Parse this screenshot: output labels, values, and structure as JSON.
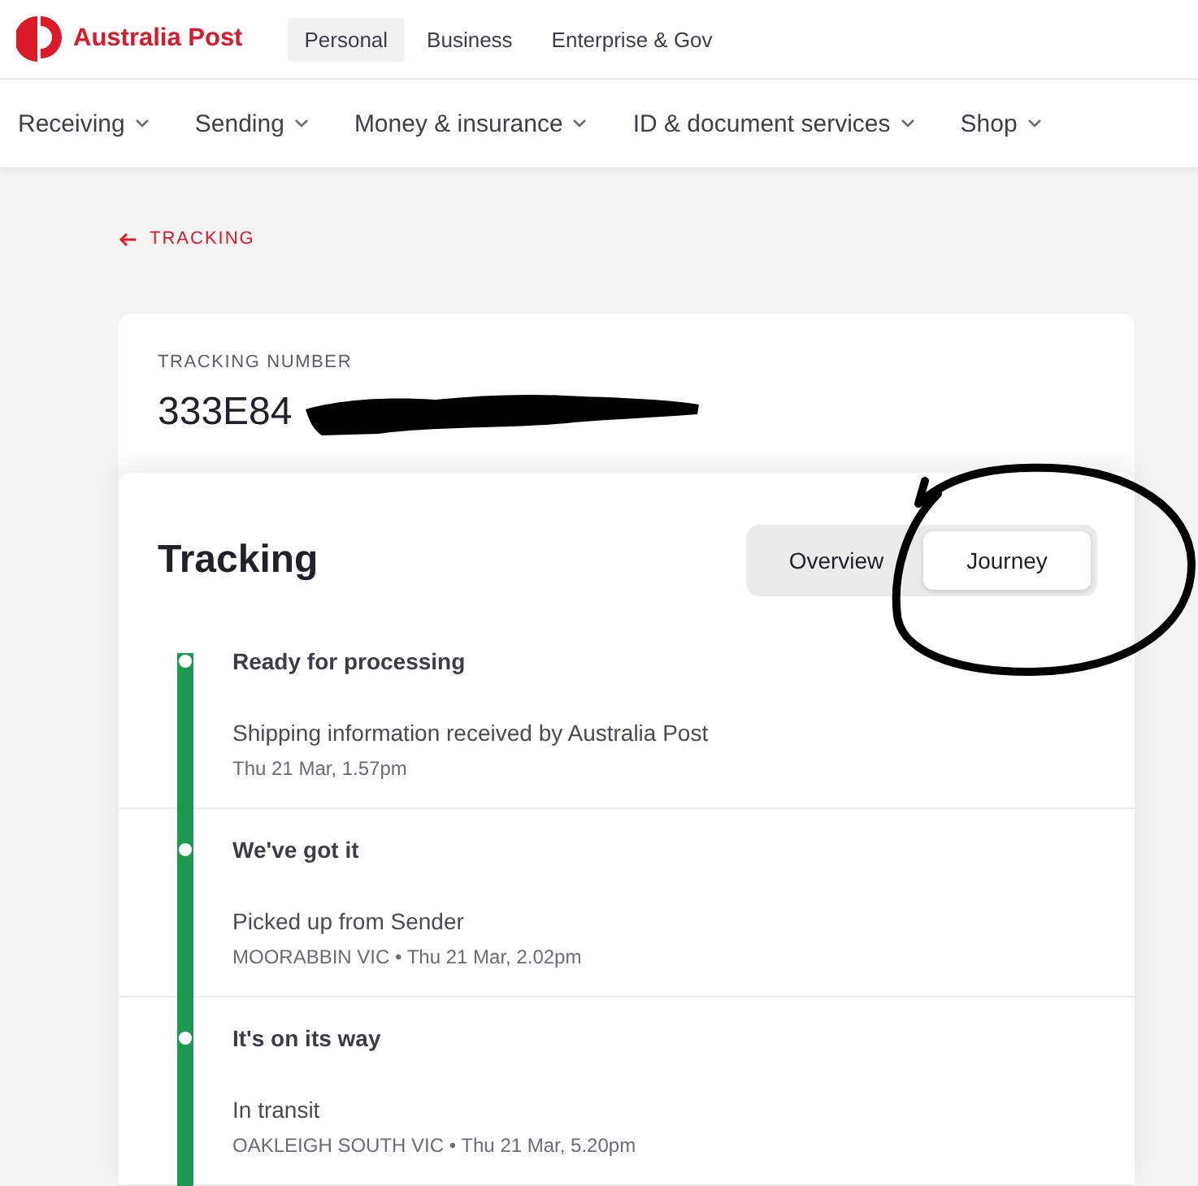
{
  "header": {
    "logo": {
      "text": "Australia Post"
    },
    "segments": [
      {
        "label": "Personal",
        "selected": true
      },
      {
        "label": "Business",
        "selected": false
      },
      {
        "label": "Enterprise & Gov",
        "selected": false
      }
    ]
  },
  "nav": {
    "items": [
      {
        "label": "Receiving"
      },
      {
        "label": "Sending"
      },
      {
        "label": "Money & insurance"
      },
      {
        "label": "ID & document services"
      },
      {
        "label": "Shop"
      }
    ]
  },
  "back_link": {
    "label": "TRACKING"
  },
  "tracking_number": {
    "label": "TRACKING NUMBER",
    "value": "333E84"
  },
  "tracking": {
    "title": "Tracking",
    "tabs": [
      {
        "label": "Overview",
        "selected": false
      },
      {
        "label": "Journey",
        "selected": true
      }
    ],
    "events": [
      {
        "title": "Ready for processing",
        "description": "Shipping information received by Australia Post",
        "meta": "Thu 21 Mar, 1.57pm"
      },
      {
        "title": "We've got it",
        "description": "Picked up from Sender",
        "meta": "MOORABBIN VIC • Thu 21 Mar, 2.02pm"
      },
      {
        "title": "It's on its way",
        "description": "In transit",
        "meta": "OAKLEIGH SOUTH VIC • Thu 21 Mar, 5.20pm"
      }
    ]
  }
}
